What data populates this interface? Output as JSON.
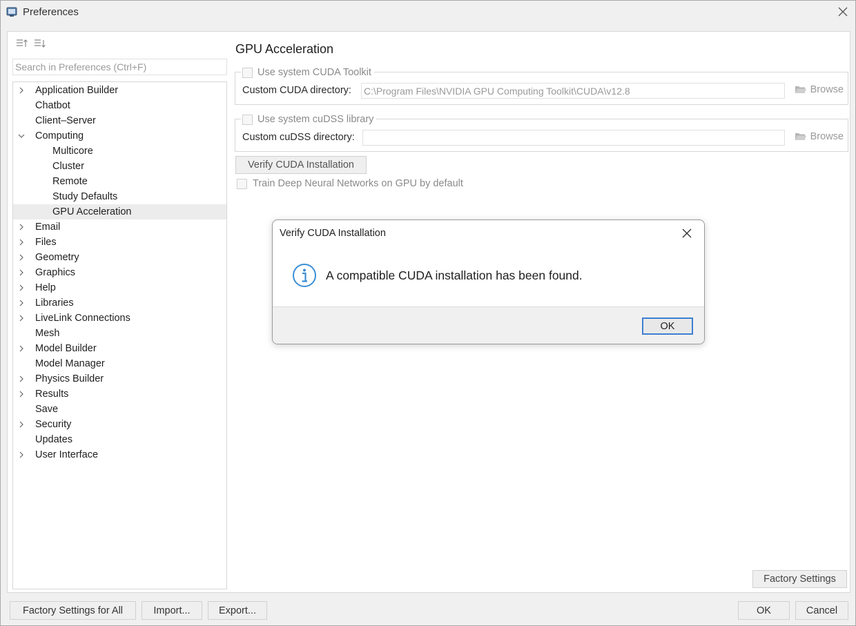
{
  "window": {
    "title": "Preferences"
  },
  "search": {
    "placeholder": "Search in Preferences (Ctrl+F)"
  },
  "tree": [
    {
      "label": "Application Builder",
      "level": 0,
      "expander": "collapsed"
    },
    {
      "label": "Chatbot",
      "level": 0,
      "expander": "none"
    },
    {
      "label": "Client–Server",
      "level": 0,
      "expander": "none"
    },
    {
      "label": "Computing",
      "level": 0,
      "expander": "expanded"
    },
    {
      "label": "Multicore",
      "level": 1,
      "expander": "none"
    },
    {
      "label": "Cluster",
      "level": 1,
      "expander": "none"
    },
    {
      "label": "Remote",
      "level": 1,
      "expander": "none"
    },
    {
      "label": "Study Defaults",
      "level": 1,
      "expander": "none"
    },
    {
      "label": "GPU Acceleration",
      "level": 1,
      "expander": "none",
      "selected": true
    },
    {
      "label": "Email",
      "level": 0,
      "expander": "collapsed"
    },
    {
      "label": "Files",
      "level": 0,
      "expander": "collapsed"
    },
    {
      "label": "Geometry",
      "level": 0,
      "expander": "collapsed"
    },
    {
      "label": "Graphics",
      "level": 0,
      "expander": "collapsed"
    },
    {
      "label": "Help",
      "level": 0,
      "expander": "collapsed"
    },
    {
      "label": "Libraries",
      "level": 0,
      "expander": "collapsed"
    },
    {
      "label": "LiveLink Connections",
      "level": 0,
      "expander": "collapsed"
    },
    {
      "label": "Mesh",
      "level": 0,
      "expander": "none"
    },
    {
      "label": "Model Builder",
      "level": 0,
      "expander": "collapsed"
    },
    {
      "label": "Model Manager",
      "level": 0,
      "expander": "none"
    },
    {
      "label": "Physics Builder",
      "level": 0,
      "expander": "collapsed"
    },
    {
      "label": "Results",
      "level": 0,
      "expander": "collapsed"
    },
    {
      "label": "Save",
      "level": 0,
      "expander": "none"
    },
    {
      "label": "Security",
      "level": 0,
      "expander": "collapsed"
    },
    {
      "label": "Updates",
      "level": 0,
      "expander": "none"
    },
    {
      "label": "User Interface",
      "level": 0,
      "expander": "collapsed"
    }
  ],
  "main": {
    "section_title": "GPU Acceleration",
    "cuda_group": {
      "checkbox_label": "Use system CUDA Toolkit",
      "checked": false,
      "dir_label": "Custom CUDA directory:",
      "dir_value": "C:\\Program Files\\NVIDIA GPU Computing Toolkit\\CUDA\\v12.8",
      "browse_label": "Browse"
    },
    "cudss_group": {
      "checkbox_label": "Use system cuDSS library",
      "checked": false,
      "dir_label": "Custom cuDSS directory:",
      "dir_value": "",
      "browse_label": "Browse"
    },
    "verify_button": "Verify CUDA Installation",
    "train_checkbox_label": "Train Deep Neural Networks on GPU by default",
    "factory_settings_button": "Factory Settings"
  },
  "footer": {
    "factory_all": "Factory Settings for All",
    "import": "Import...",
    "export": "Export...",
    "ok": "OK",
    "cancel": "Cancel"
  },
  "dialog": {
    "title": "Verify CUDA Installation",
    "message": "A compatible CUDA installation has been found.",
    "ok": "OK",
    "icon": "info-icon"
  },
  "colors": {
    "window_bg": "#f0f0f0",
    "panel_bg": "#ffffff",
    "selected_row": "#ececec",
    "disabled_text": "#8a8a8a",
    "info_icon": "#3a8fd6",
    "focus_border": "#3c7fd1"
  }
}
